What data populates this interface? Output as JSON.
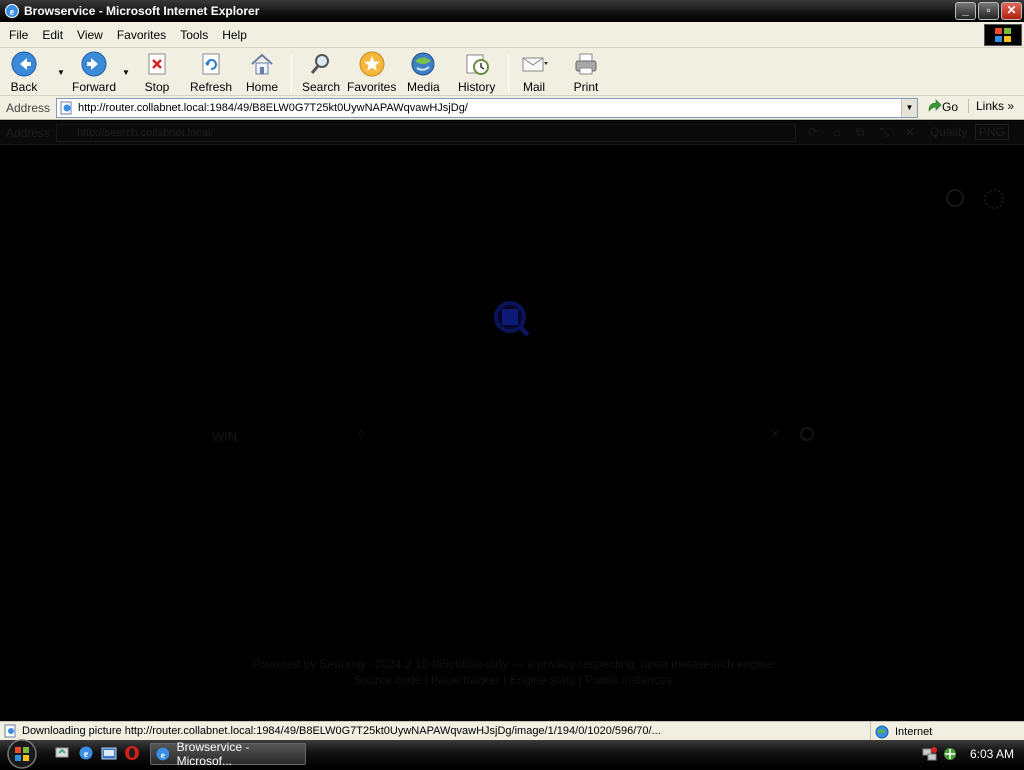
{
  "window": {
    "title": "Browservice - Microsoft Internet Explorer",
    "minimize": "_",
    "maximize": "▫",
    "close": "✕"
  },
  "menu": {
    "items": [
      "File",
      "Edit",
      "View",
      "Favorites",
      "Tools",
      "Help"
    ]
  },
  "toolbar": {
    "back": "Back",
    "forward": "Forward",
    "stop": "Stop",
    "refresh": "Refresh",
    "home": "Home",
    "search": "Search",
    "favorites": "Favorites",
    "media": "Media",
    "history": "History",
    "mail": "Mail",
    "print": "Print"
  },
  "address": {
    "label": "Address",
    "url": "http://router.collabnet.local:1984/49/B8ELW0G7T25kt0UywNAPAWqvawHJsjDg/",
    "go": "Go",
    "links": "Links"
  },
  "page": {
    "inner_address_label": "Address",
    "inner_url": "http://search.collabnet.local/",
    "inner_quality": "Quality",
    "inner_format": "PNG",
    "win_text": "WIN",
    "footer_line1": "Powered by Searxng - 2024.2.10-fa5c680a-dirty — a privacy-respecting, open metasearch engine",
    "footer_line2": "Source code | Issue tracker | Engine stats | Public instances"
  },
  "status": {
    "text": "Downloading picture http://router.collabnet.local:1984/49/B8ELW0G7T25kt0UywNAPAWqvawHJsjDg/image/1/194/0/1020/596/70/...",
    "zone": "Internet"
  },
  "taskbar": {
    "task_label": "Browservice - Microsof...",
    "clock": "6:03 AM"
  }
}
